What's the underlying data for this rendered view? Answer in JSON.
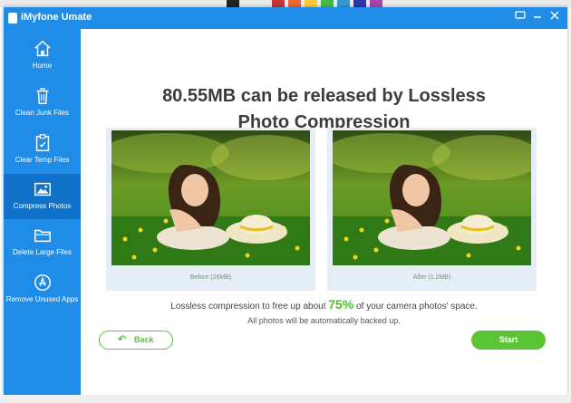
{
  "app": {
    "title": "iMyfone Umate"
  },
  "sidebar": {
    "items": [
      {
        "label": "Home",
        "icon": "home-icon",
        "active": false
      },
      {
        "label": "Clean Junk Files",
        "icon": "trash-icon",
        "active": false
      },
      {
        "label": "Clear Temp Files",
        "icon": "temp-file-icon",
        "active": false
      },
      {
        "label": "Compress Photos",
        "icon": "photo-icon",
        "active": true
      },
      {
        "label": "Delete Large Files",
        "icon": "folder-icon",
        "active": false
      },
      {
        "label": "Remove Unused Apps",
        "icon": "app-store-icon",
        "active": false
      }
    ]
  },
  "main": {
    "headline_line1": "80.55MB can be released by Lossless",
    "headline_line2": "Photo Compression",
    "before_caption": "Before (26MB)",
    "after_caption": "After (1.2MB)",
    "desc_prefix": "Lossless compression to free up about",
    "desc_percent": "75%",
    "desc_suffix": "of your camera photos' space.",
    "backup_note": "All photos will be automatically backed up.",
    "back_label": "Back",
    "start_label": "Start"
  },
  "colors": {
    "brand_blue": "#1f8ce8",
    "active_blue": "#1170c7",
    "accent_green": "#5bc435"
  }
}
